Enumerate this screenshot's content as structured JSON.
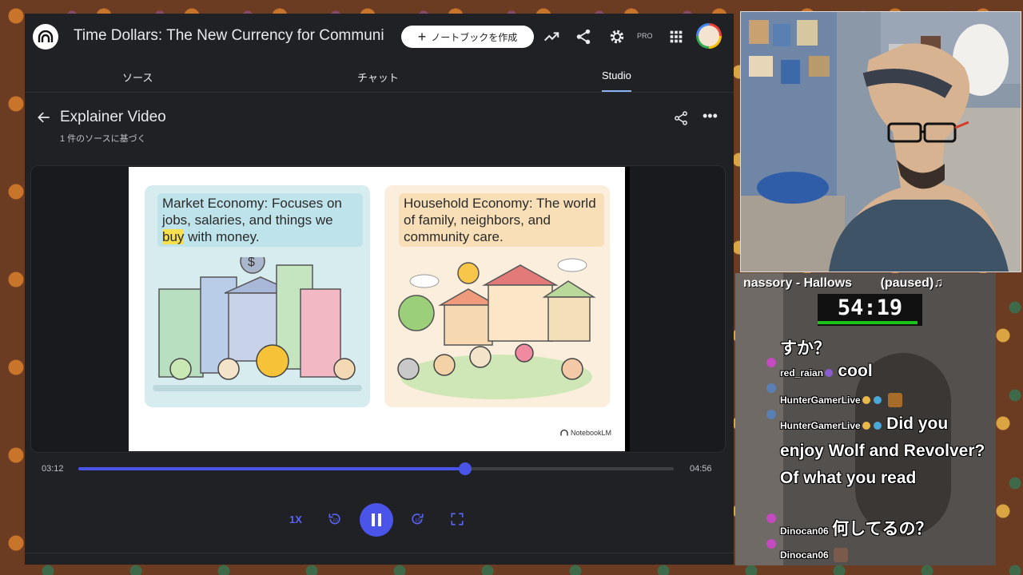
{
  "app": {
    "title": "Time Dollars: The New Currency for Communi",
    "new_notebook_label": "ノートブックを作成",
    "pro_label": "PRO"
  },
  "tabs": [
    {
      "label": "ソース"
    },
    {
      "label": "チャット"
    },
    {
      "label": "Studio",
      "active": true
    }
  ],
  "video": {
    "title": "Explainer Video",
    "subtitle": "1 件のソースに基づく"
  },
  "slide": {
    "market_caption_a": "Market Economy: Focuses on jobs, salaries, and things we ",
    "market_caption_highlight": "buy",
    "market_caption_b": " with money.",
    "household_caption": "Household Economy: The world of family, neighbors, and community care.",
    "brand": "NotebookLM"
  },
  "player": {
    "current_time": "03:12",
    "total_time": "04:56",
    "progress": 0.649,
    "speed_label": "1X",
    "accent": "#4a54e8"
  },
  "overlay": {
    "music": "nassory - Hallows        (paused)♫",
    "clock": "54:19",
    "chat": [
      {
        "user": "",
        "text": "すか？"
      },
      {
        "user": "red_raian",
        "text": "cool"
      },
      {
        "user": "HunterGamerLive",
        "text": ""
      },
      {
        "user": "HunterGamerLive",
        "text": "Did you enjoy Wolf and Revolver? Of what you read"
      },
      {
        "user": "Dinocan06",
        "text": "何してるの？"
      },
      {
        "user": "Dinocan06",
        "text": ""
      }
    ]
  }
}
